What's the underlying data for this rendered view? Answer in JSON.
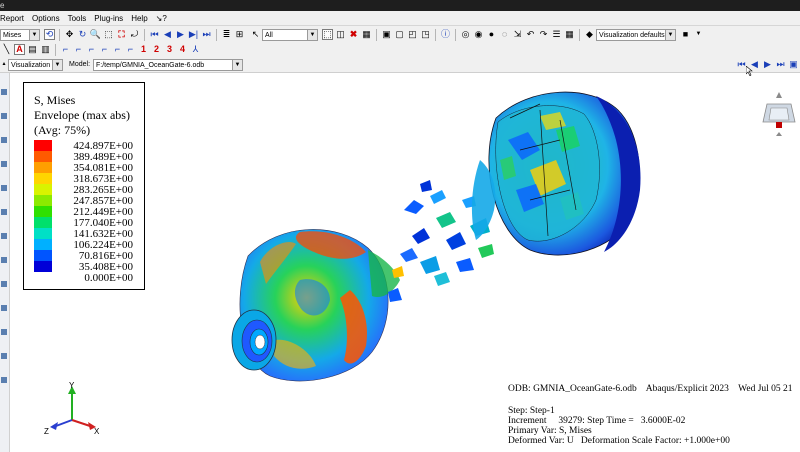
{
  "window": {
    "title": "e"
  },
  "menu": {
    "items": [
      "Report",
      "Options",
      "Tools",
      "Plug-ins",
      "Help",
      "↘?"
    ]
  },
  "toolbar1": {
    "field_output": "Mises",
    "selection_filter": "All",
    "render_style": "Visualization defaults"
  },
  "toolbar2": {
    "numbered_views": [
      "1",
      "2",
      "3",
      "4"
    ]
  },
  "context_bar": {
    "module": "Visualization",
    "model_label": "Model:",
    "model_path": "F:/temp/GMNIA_OceanGate-6.odb"
  },
  "legend": {
    "variable": "S, Mises",
    "envelope": "Envelope (max abs)",
    "averaging": "(Avg: 75%)",
    "values": [
      "424.897E+00",
      "389.489E+00",
      "354.081E+00",
      "318.673E+00",
      "283.265E+00",
      "247.857E+00",
      "212.449E+00",
      "177.040E+00",
      "141.632E+00",
      "106.224E+00",
      "70.816E+00",
      "35.408E+00",
      "0.000E+00"
    ],
    "colors": [
      "#ff0000",
      "#ff5a00",
      "#ff9f00",
      "#ffd500",
      "#d9f300",
      "#8cea00",
      "#2fe000",
      "#00e06b",
      "#00e0c6",
      "#00b0ff",
      "#0055ff",
      "#0000d8"
    ]
  },
  "viewport": {
    "odb_line": "ODB: GMNIA_OceanGate-6.odb    Abaqus/Explicit 2023    Wed Jul 05 21",
    "step": "Step: Step-1",
    "increment": "Increment     39279: Step Time =   3.6000E-02",
    "primary_var": "Primary Var: S, Mises",
    "deformed_var": "Deformed Var: U   Deformation Scale Factor: +1.000e+00"
  },
  "triad": {
    "x": "X",
    "y": "Y",
    "z": "Z"
  },
  "colors": {
    "toolbar_bg": "#f0f0f0",
    "viewport_bg": "#ffffff",
    "title_bg": "#1e1e1e"
  }
}
